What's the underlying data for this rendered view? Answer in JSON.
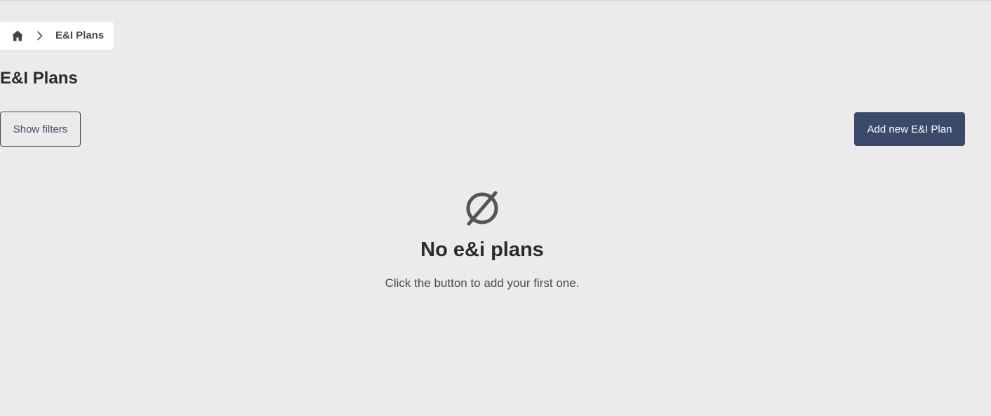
{
  "breadcrumb": {
    "home_icon": "home-icon",
    "separator_icon": "chevron-right-icon",
    "current": "E&I Plans"
  },
  "page": {
    "title": "E&I Plans"
  },
  "toolbar": {
    "show_filters_label": "Show filters",
    "add_label": "Add new E&I Plan"
  },
  "empty_state": {
    "icon": "empty-set-icon",
    "title": "No e&i plans",
    "subtitle": "Click the button to add your first one."
  },
  "colors": {
    "background": "#ebebeb",
    "primary": "#3b4a6b",
    "text": "#2b2b2b",
    "icon": "#555555"
  }
}
